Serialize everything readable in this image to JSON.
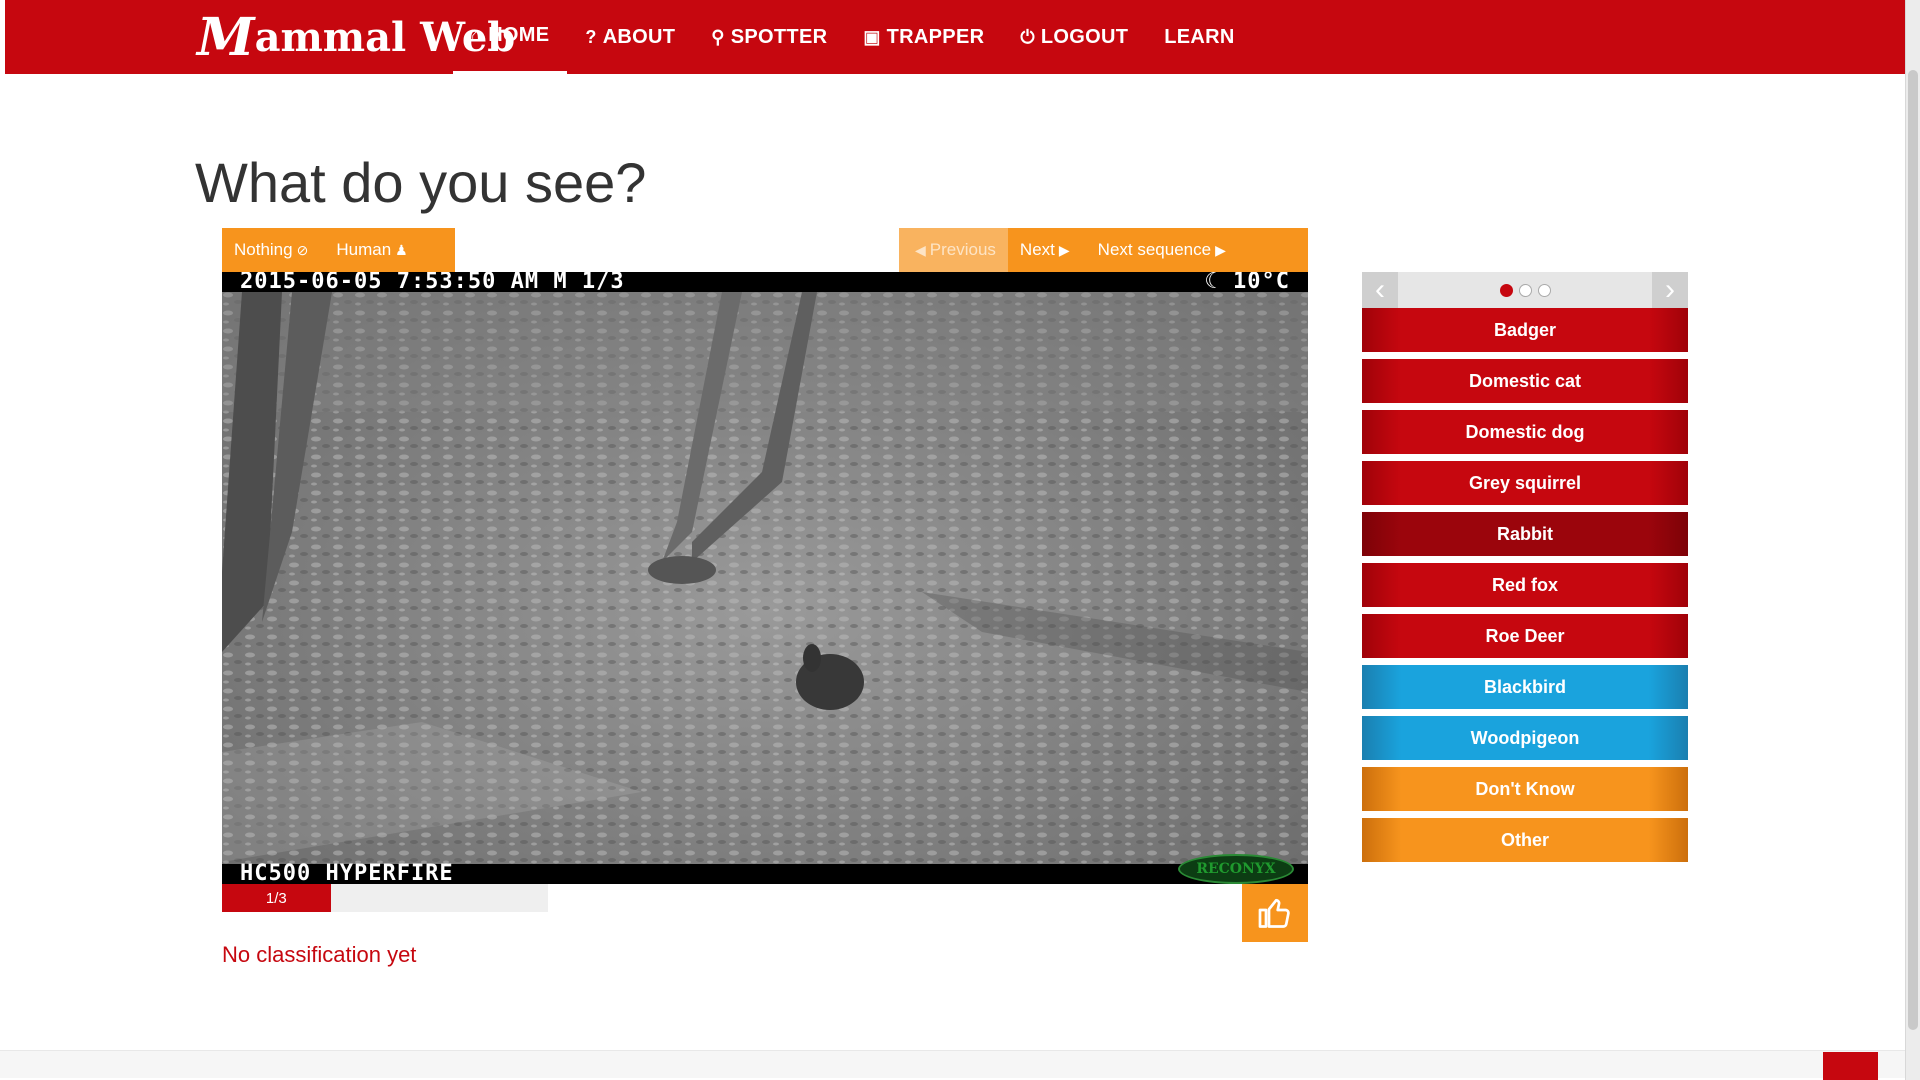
{
  "brand": {
    "logo": "Mammal Web",
    "logo_first": "M",
    "logo_rest": "ammal Web"
  },
  "nav": [
    {
      "label": "HOME",
      "icon": "home-icon",
      "glyph": "⌂"
    },
    {
      "label": "ABOUT",
      "icon": "question-icon",
      "glyph": "?"
    },
    {
      "label": "SPOTTER",
      "icon": "search-icon",
      "glyph": "⚲"
    },
    {
      "label": "TRAPPER",
      "icon": "camera-icon",
      "glyph": "▣"
    },
    {
      "label": "LOGOUT",
      "icon": "power-icon",
      "glyph": "⏻"
    },
    {
      "label": "LEARN",
      "icon": "",
      "glyph": ""
    }
  ],
  "title": "What do you see?",
  "toolbar": {
    "nothing": "Nothing",
    "human": "Human",
    "previous": "Previous",
    "next": "Next",
    "next_sequence": "Next sequence"
  },
  "camera": {
    "timestamp": "2015-06-05 7:53:50 AM   M 1/3",
    "moon_temp": "10°C",
    "model": "HC500 HYPERFIRE",
    "brand": "RECONYX"
  },
  "progress": {
    "label": "1/3",
    "fraction": 0.3333
  },
  "classification_status": "No classification yet",
  "species": [
    {
      "label": "Badger",
      "type": "red"
    },
    {
      "label": "Domestic cat",
      "type": "red"
    },
    {
      "label": "Domestic dog",
      "type": "red"
    },
    {
      "label": "Grey squirrel",
      "type": "red"
    },
    {
      "label": "Rabbit",
      "type": "red",
      "hover": true
    },
    {
      "label": "Red fox",
      "type": "red"
    },
    {
      "label": "Roe Deer",
      "type": "red"
    },
    {
      "label": "Blackbird",
      "type": "blue"
    },
    {
      "label": "Woodpigeon",
      "type": "blue"
    },
    {
      "label": "Don't Know",
      "type": "orange"
    },
    {
      "label": "Other",
      "type": "orange"
    }
  ],
  "carousel": {
    "pages": 3,
    "active": 0
  },
  "colors": {
    "brand_red": "#c6070f",
    "orange": "#f7941d",
    "blue": "#1aa3dd"
  }
}
